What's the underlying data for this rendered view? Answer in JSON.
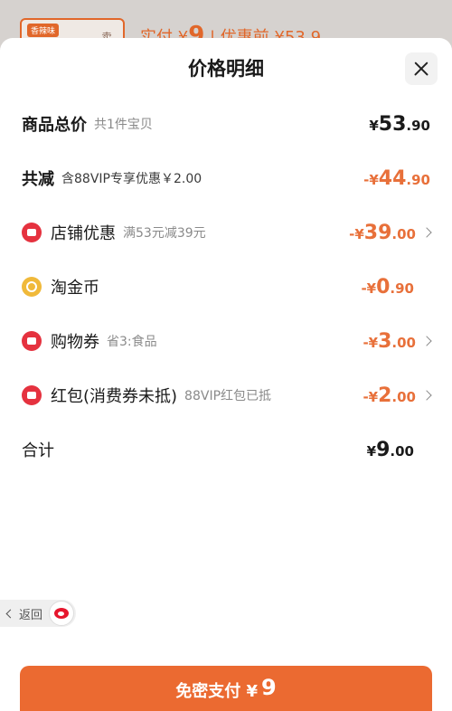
{
  "background": {
    "card_tag": "香辣味",
    "card_glyph": "卖",
    "pay_prefix": "实付 ¥",
    "pay_amount": "9",
    "pay_suffix": " | 优惠前 ¥53.9"
  },
  "sheet": {
    "title": "价格明细",
    "rows": [
      {
        "label": "商品总价",
        "sub": "共1件宝贝",
        "currency": "¥",
        "int": "53",
        "dec": ".90"
      },
      {
        "label": "共减",
        "sub": "含88VIP专享优惠￥2.00",
        "currency": "-¥",
        "int": "44",
        "dec": ".90"
      },
      {
        "label": "店铺优惠",
        "sub": "满53元减39元",
        "currency": "-¥",
        "int": "39",
        "dec": ".00"
      },
      {
        "label": "淘金币",
        "sub": "",
        "currency": "-¥",
        "int": "0",
        "dec": ".90"
      },
      {
        "label": "购物券",
        "sub": "省3:食品",
        "currency": "-¥",
        "int": "3",
        "dec": ".00"
      },
      {
        "label": "红包(消费券未抵)",
        "sub": "88VIP红包已抵",
        "currency": "-¥",
        "int": "2",
        "dec": ".00"
      },
      {
        "label": "合计",
        "sub": "",
        "currency": "¥",
        "int": "9",
        "dec": ".00"
      }
    ]
  },
  "back_pill": {
    "label": "返回"
  },
  "pay_button": {
    "label": "免密支付 ¥",
    "amount": "9"
  },
  "colors": {
    "accent": "#eb6a31",
    "discount": "#e8703a",
    "coupon_red": "#e5323f",
    "coin_gold": "#f0b93a"
  },
  "icons": [
    "close-icon",
    "shop-coupon-icon",
    "gold-coin-icon",
    "shopping-voucher-icon",
    "red-packet-icon",
    "chevron-right-icon",
    "back-arrow-icon",
    "weibo-icon"
  ]
}
